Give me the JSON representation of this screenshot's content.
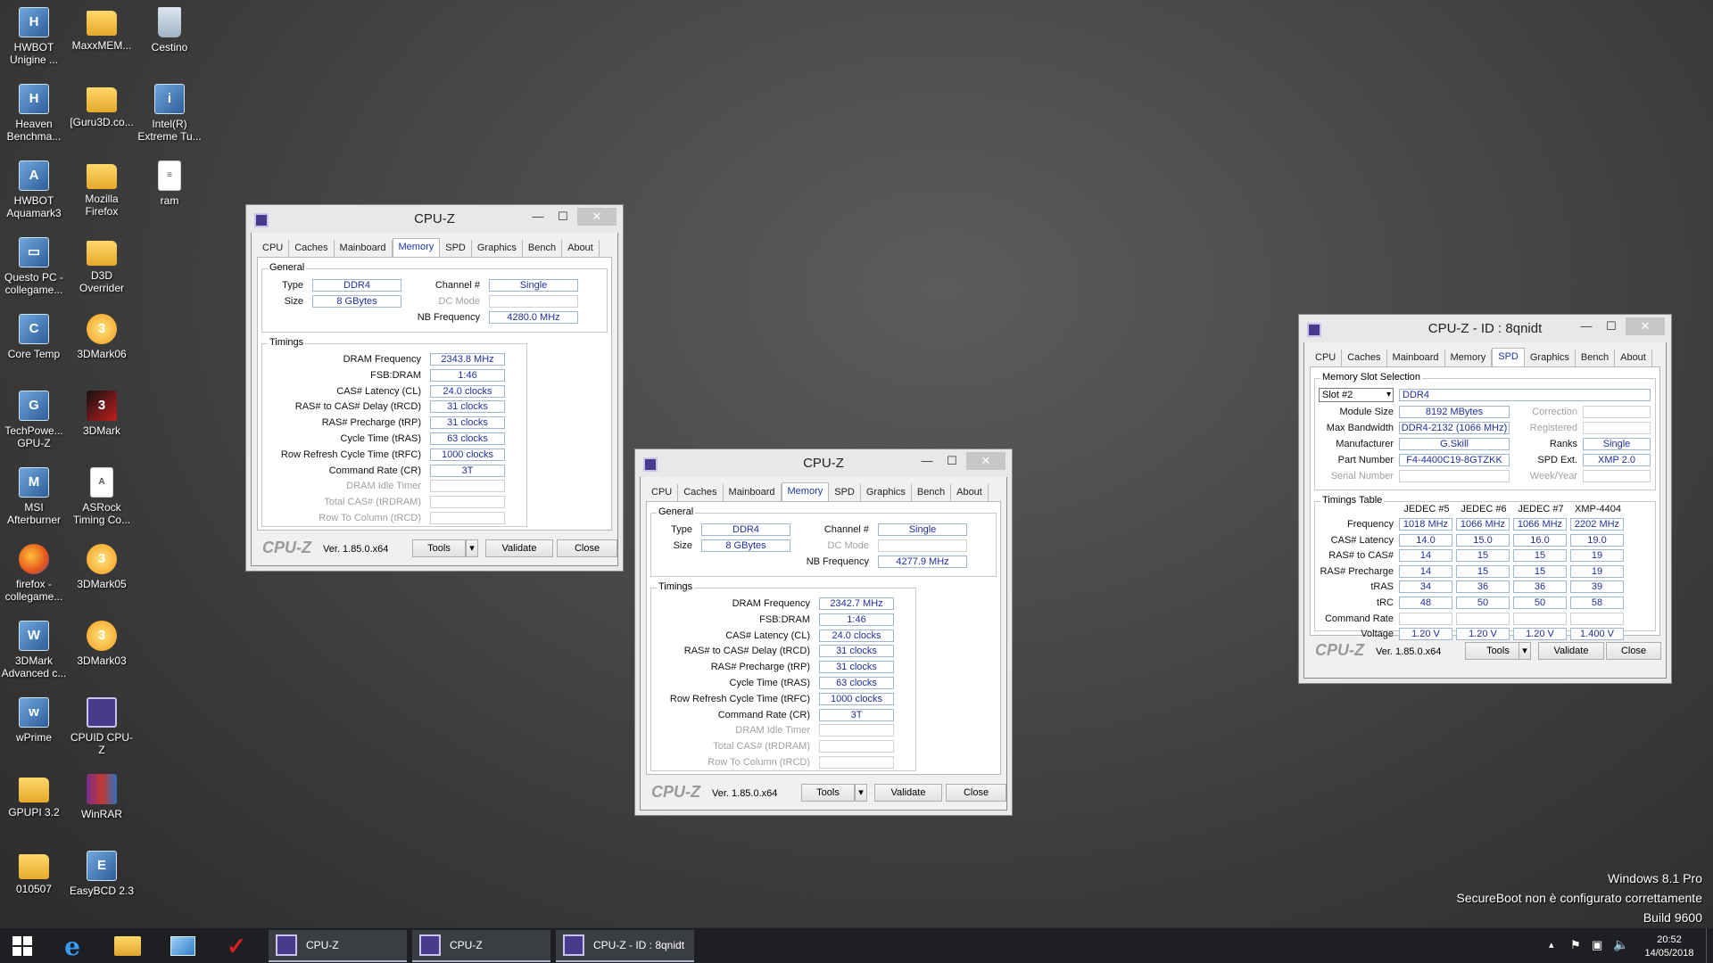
{
  "desktop": {
    "icons": [
      {
        "label": "HWBOT\nUnigine ...",
        "icon": "hwbot-unigine-icon",
        "kind": "app",
        "glyph": "H"
      },
      {
        "label": "MaxxMEM...",
        "icon": "folder-icon",
        "kind": "folder",
        "glyph": ""
      },
      {
        "label": "Cestino",
        "icon": "recycle-bin-icon",
        "kind": "bin",
        "glyph": ""
      },
      {
        "label": "Heaven\nBenchma...",
        "icon": "heaven-benchmark-icon",
        "kind": "app",
        "glyph": "H"
      },
      {
        "label": "[Guru3D.co...",
        "icon": "folder-icon",
        "kind": "folder",
        "glyph": ""
      },
      {
        "label": "Intel(R)\nExtreme Tu...",
        "icon": "intel-xtu-icon",
        "kind": "app",
        "glyph": "i"
      },
      {
        "label": "HWBOT\nAquamark3",
        "icon": "hwbot-aquamark-icon",
        "kind": "app",
        "glyph": "A"
      },
      {
        "label": "Mozilla\nFirefox",
        "icon": "folder-icon",
        "kind": "folder",
        "glyph": ""
      },
      {
        "label": "ram",
        "icon": "text-file-icon",
        "kind": "file",
        "glyph": "≡"
      },
      {
        "label": "Questo PC -\ncollegame...",
        "icon": "this-pc-icon",
        "kind": "app",
        "glyph": "▭"
      },
      {
        "label": "D3D\nOverrider",
        "icon": "folder-icon",
        "kind": "folder",
        "glyph": ""
      },
      {
        "label": "",
        "icon": "",
        "kind": "none",
        "glyph": ""
      },
      {
        "label": "Core Temp",
        "icon": "core-temp-icon",
        "kind": "app",
        "glyph": "C"
      },
      {
        "label": "3DMark06",
        "icon": "3dmark06-icon",
        "kind": "mark",
        "glyph": "3"
      },
      {
        "label": "",
        "icon": "",
        "kind": "none",
        "glyph": ""
      },
      {
        "label": "TechPowe...\nGPU-Z",
        "icon": "gpu-z-icon",
        "kind": "app",
        "glyph": "G"
      },
      {
        "label": "3DMark",
        "icon": "3dmark-icon",
        "kind": "red",
        "glyph": "3"
      },
      {
        "label": "",
        "icon": "",
        "kind": "none",
        "glyph": ""
      },
      {
        "label": "MSI\nAfterburner",
        "icon": "msi-afterburner-icon",
        "kind": "app",
        "glyph": "M"
      },
      {
        "label": "ASRock\nTiming Co...",
        "icon": "asrock-timing-icon",
        "kind": "file",
        "glyph": "A"
      },
      {
        "label": "",
        "icon": "",
        "kind": "none",
        "glyph": ""
      },
      {
        "label": "firefox -\ncollegame...",
        "icon": "firefox-icon",
        "kind": "fox",
        "glyph": ""
      },
      {
        "label": "3DMark05",
        "icon": "3dmark05-icon",
        "kind": "mark",
        "glyph": "3"
      },
      {
        "label": "",
        "icon": "",
        "kind": "none",
        "glyph": ""
      },
      {
        "label": "3DMark\nAdvanced c...",
        "icon": "3dmark-advanced-icon",
        "kind": "app",
        "glyph": "W"
      },
      {
        "label": "3DMark03",
        "icon": "3dmark03-icon",
        "kind": "mark",
        "glyph": "3"
      },
      {
        "label": "",
        "icon": "",
        "kind": "none",
        "glyph": ""
      },
      {
        "label": "wPrime",
        "icon": "wprime-icon",
        "kind": "app",
        "glyph": "w"
      },
      {
        "label": "CPUID CPU-Z",
        "icon": "cpuid-cpuz-icon",
        "kind": "cpuz",
        "glyph": ""
      },
      {
        "label": "",
        "icon": "",
        "kind": "none",
        "glyph": ""
      },
      {
        "label": "GPUPI 3.2",
        "icon": "folder-icon",
        "kind": "folder",
        "glyph": ""
      },
      {
        "label": "WinRAR",
        "icon": "winrar-icon",
        "kind": "rar",
        "glyph": ""
      },
      {
        "label": "",
        "icon": "",
        "kind": "none",
        "glyph": ""
      },
      {
        "label": "010507",
        "icon": "folder-icon",
        "kind": "folder",
        "glyph": ""
      },
      {
        "label": "EasyBCD 2.3",
        "icon": "easybcd-icon",
        "kind": "app",
        "glyph": "E"
      }
    ]
  },
  "tabs": [
    "CPU",
    "Caches",
    "Mainboard",
    "Memory",
    "SPD",
    "Graphics",
    "Bench",
    "About"
  ],
  "memwin": {
    "title": "CPU-Z",
    "general_label": "General",
    "type_label": "Type",
    "type": "DDR4",
    "size_label": "Size",
    "size": "8 GBytes",
    "channel_label": "Channel #",
    "channel": "Single",
    "dcmode_label": "DC Mode",
    "nbfreq_label": "NB Frequency",
    "timings_label": "Timings",
    "rows": [
      {
        "label": "DRAM Frequency",
        "dim": false
      },
      {
        "label": "FSB:DRAM",
        "dim": false
      },
      {
        "label": "CAS# Latency (CL)",
        "dim": false
      },
      {
        "label": "RAS# to CAS# Delay (tRCD)",
        "dim": false
      },
      {
        "label": "RAS# Precharge (tRP)",
        "dim": false
      },
      {
        "label": "Cycle Time (tRAS)",
        "dim": false
      },
      {
        "label": "Row Refresh Cycle Time (tRFC)",
        "dim": false
      },
      {
        "label": "Command Rate (CR)",
        "dim": false
      },
      {
        "label": "DRAM Idle Timer",
        "dim": true
      },
      {
        "label": "Total CAS# (tRDRAM)",
        "dim": true
      },
      {
        "label": "Row To Column (tRCD)",
        "dim": true
      }
    ]
  },
  "win1": {
    "nbfreq": "4280.0 MHz",
    "values": [
      "2343.8 MHz",
      "1:46",
      "24.0 clocks",
      "31 clocks",
      "31 clocks",
      "63 clocks",
      "1000 clocks",
      "3T",
      "",
      "",
      ""
    ]
  },
  "win2": {
    "nbfreq": "4277.9 MHz",
    "values": [
      "2342.7 MHz",
      "1:46",
      "24.0 clocks",
      "31 clocks",
      "31 clocks",
      "63 clocks",
      "1000 clocks",
      "3T",
      "",
      "",
      ""
    ]
  },
  "bottom": {
    "brand": "CPU-Z",
    "version": "Ver. 1.85.0.x64",
    "tools": "Tools",
    "validate": "Validate",
    "close": "Close"
  },
  "spd": {
    "title": "CPU-Z - ID : 8qnidt",
    "slot_group": "Memory Slot Selection",
    "slot": "Slot #2",
    "slot_type": "DDR4",
    "left_rows": [
      {
        "label": "Module Size",
        "value": "8192 MBytes",
        "dim": false
      },
      {
        "label": "Max Bandwidth",
        "value": "DDR4-2132 (1066 MHz)",
        "dim": false
      },
      {
        "label": "Manufacturer",
        "value": "G.Skill",
        "dim": false
      },
      {
        "label": "Part Number",
        "value": "F4-4400C19-8GTZKK",
        "dim": false
      },
      {
        "label": "Serial Number",
        "value": "",
        "dim": true
      }
    ],
    "right_rows": [
      {
        "label": "Correction",
        "value": "",
        "dim": true
      },
      {
        "label": "Registered",
        "value": "",
        "dim": true
      },
      {
        "label": "Ranks",
        "value": "Single",
        "dim": false
      },
      {
        "label": "SPD Ext.",
        "value": "XMP 2.0",
        "dim": false
      },
      {
        "label": "Week/Year",
        "value": "",
        "dim": true
      }
    ],
    "timings_group": "Timings Table",
    "columns": [
      "JEDEC #5",
      "JEDEC #6",
      "JEDEC #7",
      "XMP-4404"
    ],
    "trows": [
      {
        "label": "Frequency",
        "cells": [
          "1018 MHz",
          "1066 MHz",
          "1066 MHz",
          "2202 MHz"
        ]
      },
      {
        "label": "CAS# Latency",
        "cells": [
          "14.0",
          "15.0",
          "16.0",
          "19.0"
        ]
      },
      {
        "label": "RAS# to CAS#",
        "cells": [
          "14",
          "15",
          "15",
          "19"
        ]
      },
      {
        "label": "RAS# Precharge",
        "cells": [
          "14",
          "15",
          "15",
          "19"
        ]
      },
      {
        "label": "tRAS",
        "cells": [
          "34",
          "36",
          "36",
          "39"
        ]
      },
      {
        "label": "tRC",
        "cells": [
          "48",
          "50",
          "50",
          "58"
        ]
      },
      {
        "label": "Command Rate",
        "cells": [
          "",
          "",
          "",
          ""
        ]
      },
      {
        "label": "Voltage",
        "cells": [
          "1.20 V",
          "1.20 V",
          "1.20 V",
          "1.400 V"
        ]
      }
    ]
  },
  "taskbar": {
    "tasks": [
      "CPU-Z",
      "CPU-Z",
      "CPU-Z - ID : 8qnidt"
    ],
    "time": "20:52",
    "date": "14/05/2018"
  },
  "watermark": {
    "line1": "Windows 8.1 Pro",
    "line2": "SecureBoot non è configurato correttamente",
    "line3": "Build 9600"
  },
  "colors": {
    "accent": "#1a39a8",
    "value_text": "#1f2f9a",
    "taskbar": "#1d1f22"
  }
}
